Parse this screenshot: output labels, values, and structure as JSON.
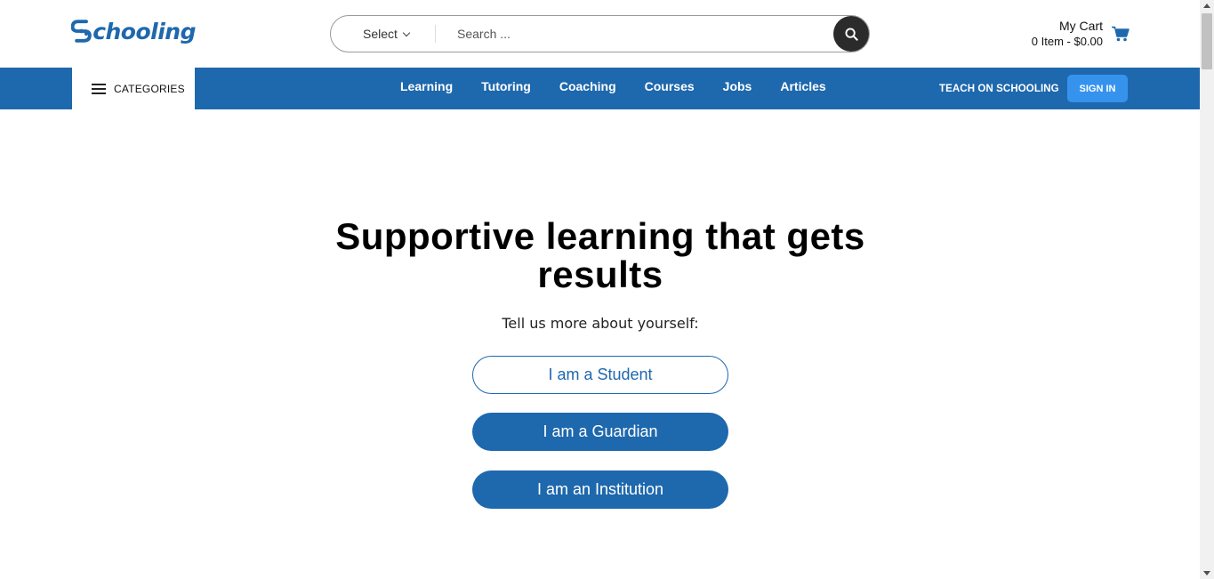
{
  "header": {
    "logo_text": "chooling",
    "search": {
      "select_label": "Select",
      "placeholder": "Search ..."
    },
    "cart": {
      "title": "My Cart",
      "summary": "0 Item - $0.00",
      "icon": "shopping-cart-icon"
    }
  },
  "navbar": {
    "categories_label": "CATEGORIES",
    "links": [
      "Learning",
      "Tutoring",
      "Coaching",
      "Courses",
      "Jobs",
      "Articles"
    ],
    "teach_label": "TEACH ON SCHOOLING",
    "signin_label": "SIGN IN"
  },
  "hero": {
    "title": "Supportive learning that gets results",
    "subtitle": "Tell us more about yourself:",
    "buttons": {
      "student": "I am a Student",
      "guardian": "I am a Guardian",
      "institution": "I am an Institution"
    }
  },
  "colors": {
    "brand_blue": "#1e68ad",
    "signin_blue": "#3593ee",
    "search_button": "#2b2b2b"
  }
}
